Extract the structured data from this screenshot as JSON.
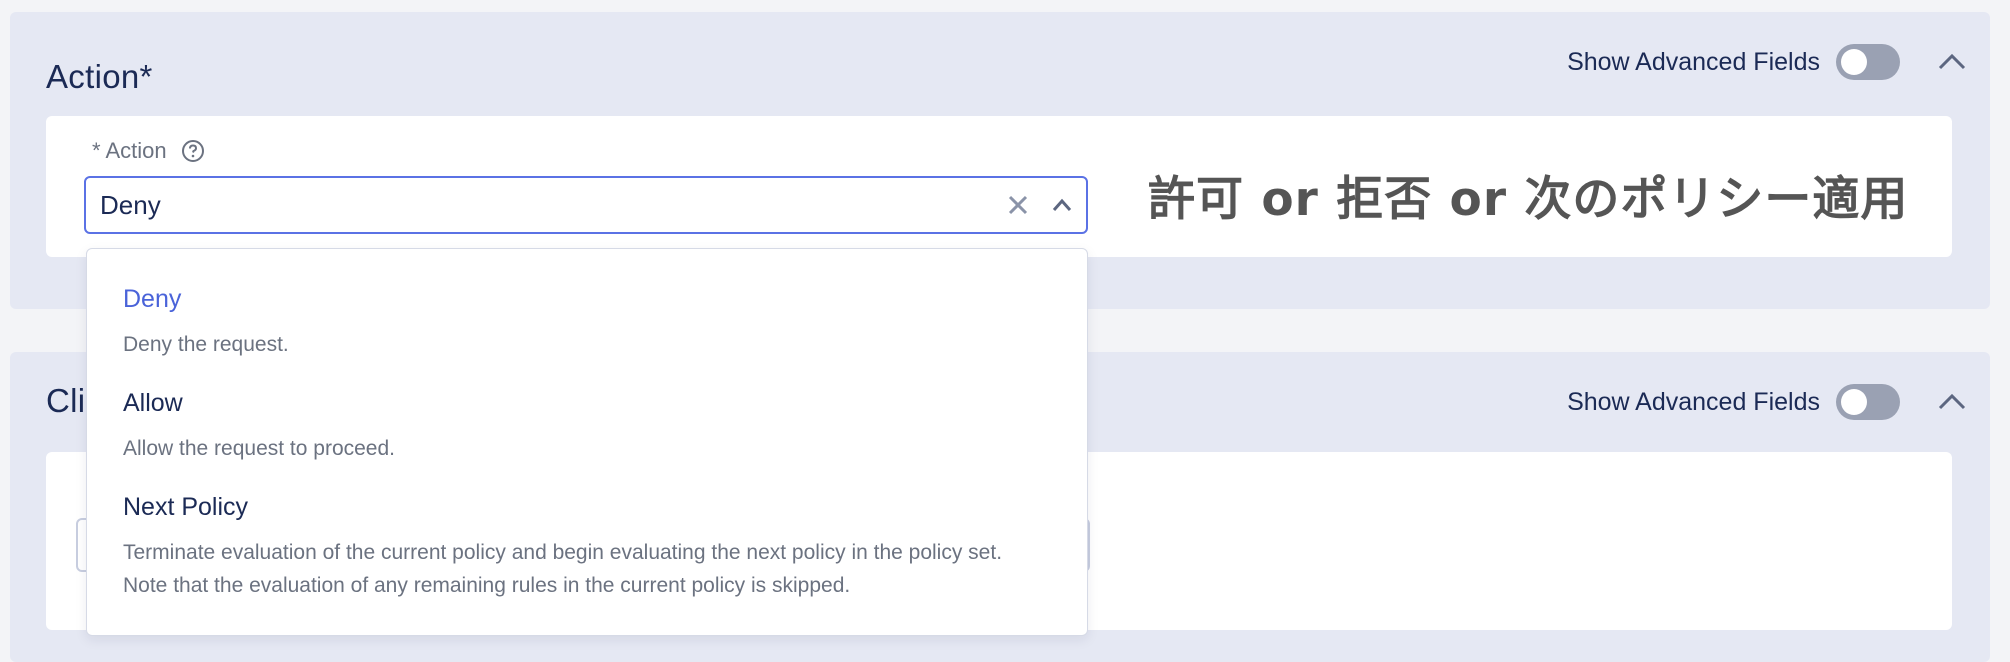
{
  "action_section": {
    "title": "Action*",
    "advanced_label": "Show Advanced Fields",
    "advanced_toggle": "off",
    "field": {
      "label": "* Action",
      "value": "Deny"
    },
    "annotation": "許可 or 拒否 or 次のポリシー適用",
    "dropdown": {
      "options": [
        {
          "title": "Deny",
          "description": "Deny the request.",
          "selected": true
        },
        {
          "title": "Allow",
          "description": "Allow the request to proceed.",
          "selected": false
        },
        {
          "title": "Next Policy",
          "description": "Terminate evaluation of the current policy and begin evaluating the next policy in the policy set. Note that the evaluation of any remaining rules in the current policy is skipped.",
          "selected": false
        }
      ]
    }
  },
  "client_section": {
    "title": "Cli",
    "advanced_label": "Show Advanced Fields",
    "advanced_toggle": "off"
  },
  "colors": {
    "accent": "#4a63d9",
    "focus_border": "#5b72e5",
    "section_bg": "#e5e8f3",
    "text_dark": "#1b2a55",
    "text_muted": "#6b7280",
    "toggle_off": "#9aa1b3"
  }
}
